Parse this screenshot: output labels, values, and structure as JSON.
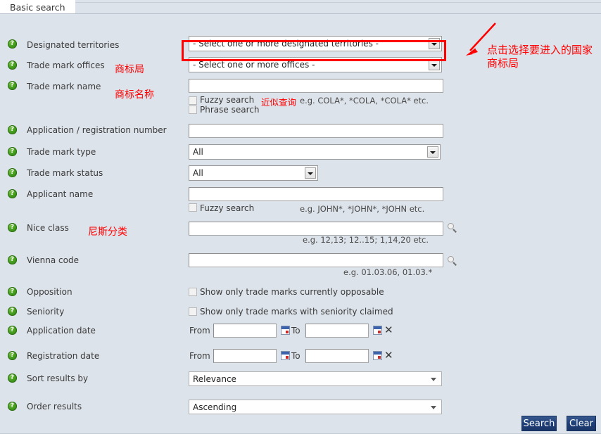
{
  "tab": {
    "label": "Basic search"
  },
  "rows": {
    "designated_territories": {
      "label": "Designated territories",
      "select_value": "- Select one or more designated territories -"
    },
    "trade_mark_offices": {
      "label": "Trade mark offices",
      "annotation_cn": "商标局",
      "select_value": "- Select one or more offices -",
      "callout_cn_line1": "点击选择要进入的国家",
      "callout_cn_line2": "商标局"
    },
    "trade_mark_name": {
      "label": "Trade mark name",
      "annotation_cn": "商标名称",
      "input_value": "",
      "fuzzy_label": "Fuzzy search",
      "fuzzy_cn": "近似查询",
      "phrase_label": "Phrase search",
      "hint": "e.g. COLA*, *COLA, *COLA* etc."
    },
    "application_registration_number": {
      "label": "Application / registration number",
      "input_value": ""
    },
    "trade_mark_type": {
      "label": "Trade mark type",
      "select_value": "All"
    },
    "trade_mark_status": {
      "label": "Trade mark status",
      "select_value": "All"
    },
    "applicant_name": {
      "label": "Applicant name",
      "input_value": "",
      "fuzzy_label": "Fuzzy search",
      "hint": "e.g. JOHN*, *JOHN*, *JOHN etc."
    },
    "nice_class": {
      "label": "Nice class",
      "annotation_cn": "尼斯分类",
      "input_value": "",
      "hint": "e.g. 12,13; 12..15; 1,14,20 etc."
    },
    "vienna_code": {
      "label": "Vienna code",
      "input_value": "",
      "hint": "e.g. 01.03.06, 01.03.*"
    },
    "opposition": {
      "label": "Opposition",
      "checkbox_label": "Show only trade marks currently opposable"
    },
    "seniority": {
      "label": "Seniority",
      "checkbox_label": "Show only trade marks with seniority claimed"
    },
    "application_date": {
      "label": "Application date",
      "from_label": "From",
      "to_label": "To",
      "from_value": "",
      "to_value": ""
    },
    "registration_date": {
      "label": "Registration date",
      "from_label": "From",
      "to_label": "To",
      "from_value": "",
      "to_value": ""
    },
    "sort_results_by": {
      "label": "Sort results by",
      "select_value": "Relevance"
    },
    "order_results": {
      "label": "Order results",
      "select_value": "Ascending"
    }
  },
  "footer": {
    "search_label": "Search",
    "clear_label": "Clear"
  },
  "icons": {
    "help": "?",
    "clear_x": "✕"
  },
  "colors": {
    "page_bg": "#dde3ea",
    "annotation_red": "#ff0000",
    "help_green": "#46a01f",
    "button_blue": "#1f3f78"
  }
}
